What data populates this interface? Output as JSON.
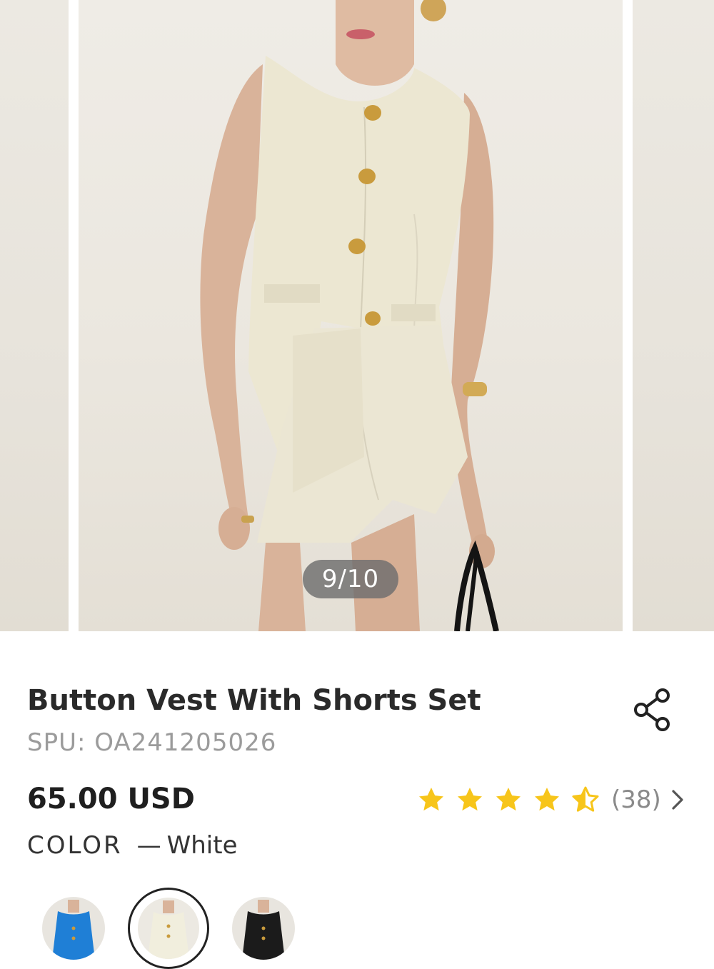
{
  "gallery": {
    "counter": "9/10",
    "current_index": 9,
    "total": 10
  },
  "product": {
    "title": "Button Vest With Shorts Set",
    "spu": "SPU: OA241205026",
    "price": "65.00 USD",
    "rating": {
      "stars": 4.5,
      "count_label": "(38)",
      "star_color": "#f7c51a"
    },
    "color": {
      "label": "COLOR",
      "separator": "—",
      "selected": "White"
    },
    "swatches": [
      {
        "name": "Blue",
        "color": "#1f7fd6",
        "selected": false
      },
      {
        "name": "White",
        "color": "#f1eedd",
        "selected": true
      },
      {
        "name": "Black",
        "color": "#1b1b1b",
        "selected": false
      }
    ]
  },
  "icons": {
    "share": "share-icon",
    "chevron": "chevron-right-icon"
  }
}
